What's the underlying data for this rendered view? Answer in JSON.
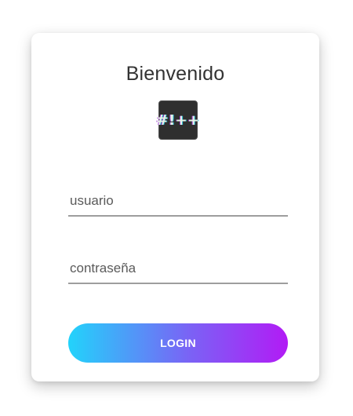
{
  "login_card": {
    "title": "Bienvenido",
    "logo_text": "#!++",
    "username": {
      "placeholder": "usuario",
      "value": ""
    },
    "password": {
      "placeholder": "contraseña",
      "value": ""
    },
    "login_button_label": "LOGIN"
  },
  "colors": {
    "button_gradient_start": "#22d3fb",
    "button_gradient_end": "#b21bf5",
    "logo_background": "#2f2f2f",
    "field_underline": "#9e9e9e"
  }
}
